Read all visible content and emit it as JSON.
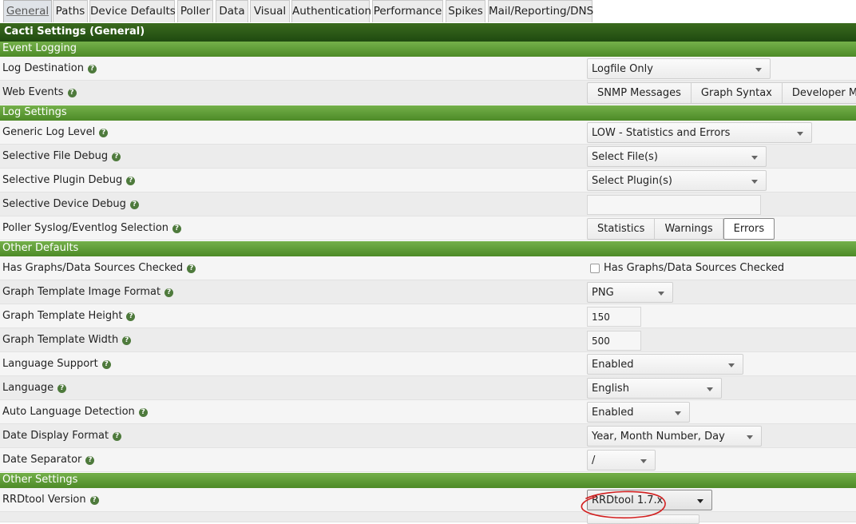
{
  "tabs": [
    {
      "label": "General",
      "active": true
    },
    {
      "label": "Paths"
    },
    {
      "label": "Device Defaults"
    },
    {
      "label": "Poller"
    },
    {
      "label": "Data"
    },
    {
      "label": "Visual"
    },
    {
      "label": "Authentication"
    },
    {
      "label": "Performance"
    },
    {
      "label": "Spikes"
    },
    {
      "label": "Mail/Reporting/DNS"
    }
  ],
  "page_title": "Cacti Settings (General)",
  "sections": {
    "event_logging": "Event Logging",
    "log_settings": "Log Settings",
    "other_defaults": "Other Defaults",
    "other_settings": "Other Settings"
  },
  "help_glyph": "?",
  "fields": {
    "log_destination": {
      "label": "Log Destination",
      "value": "Logfile Only"
    },
    "web_events": {
      "label": "Web Events",
      "options": [
        "SNMP Messages",
        "Graph Syntax",
        "Developer Mode"
      ]
    },
    "generic_log_level": {
      "label": "Generic Log Level",
      "value": "LOW - Statistics and Errors"
    },
    "selective_file_debug": {
      "label": "Selective File Debug",
      "value": "Select File(s)"
    },
    "selective_plugin_debug": {
      "label": "Selective Plugin Debug",
      "value": "Select Plugin(s)"
    },
    "selective_device_debug": {
      "label": "Selective Device Debug",
      "value": ""
    },
    "poller_syslog": {
      "label": "Poller Syslog/Eventlog Selection",
      "options": [
        "Statistics",
        "Warnings",
        "Errors"
      ],
      "selected": "Errors"
    },
    "has_graphs": {
      "label": "Has Graphs/Data Sources Checked",
      "checkbox_label": "Has Graphs/Data Sources Checked",
      "checked": false
    },
    "image_format": {
      "label": "Graph Template Image Format",
      "value": "PNG"
    },
    "graph_height": {
      "label": "Graph Template Height",
      "value": "150"
    },
    "graph_width": {
      "label": "Graph Template Width",
      "value": "500"
    },
    "language_support": {
      "label": "Language Support",
      "value": "Enabled"
    },
    "language": {
      "label": "Language",
      "value": "English"
    },
    "auto_language": {
      "label": "Auto Language Detection",
      "value": "Enabled"
    },
    "date_format": {
      "label": "Date Display Format",
      "value": "Year, Month Number, Day"
    },
    "date_separator": {
      "label": "Date Separator",
      "value": "/"
    },
    "rrdtool_version": {
      "label": "RRDtool Version",
      "value": "RRDtool 1.7.x"
    }
  },
  "colors": {
    "header_dark_green": "#2c5a17",
    "section_green": "#5e9a36",
    "annotation_red": "#d21f1f"
  }
}
